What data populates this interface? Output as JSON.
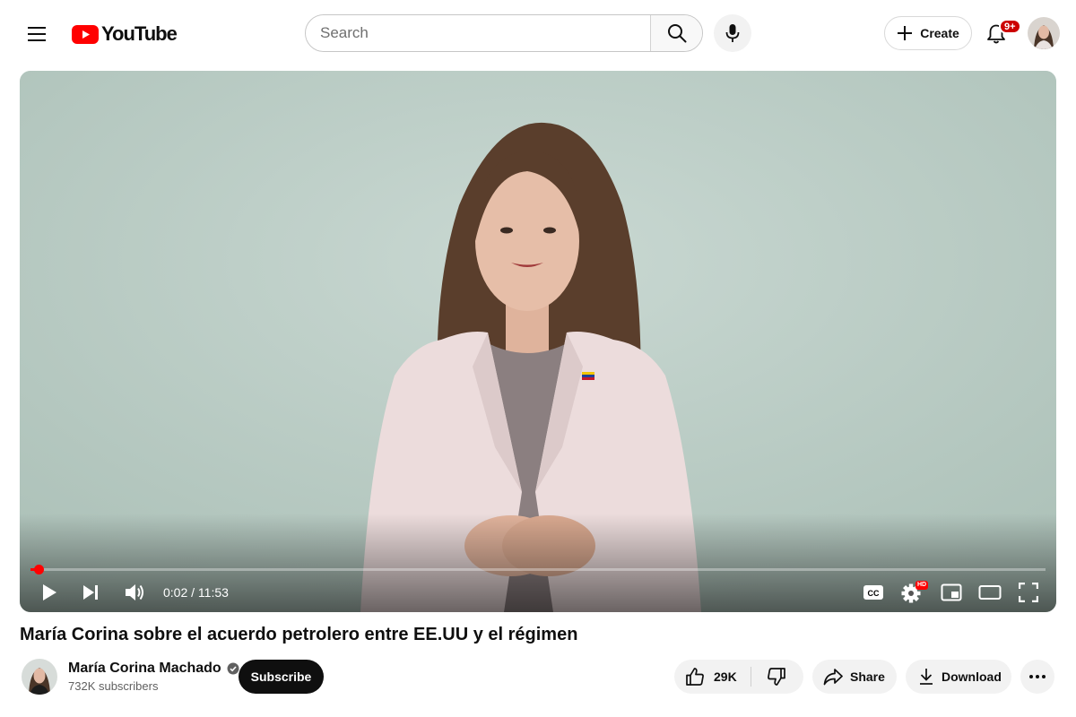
{
  "masthead": {
    "logo_text": "YouTube",
    "search_placeholder": "Search",
    "create_label": "Create",
    "notifications_badge": "9+"
  },
  "player": {
    "current_time": "0:02",
    "separator": " / ",
    "duration": "11:53",
    "progress_fraction": 0.003,
    "quality_badge": "HD"
  },
  "video": {
    "title": "María Corina sobre el acuerdo petrolero entre EE.UU y el régimen"
  },
  "channel": {
    "name": "María Corina Machado",
    "verified": true,
    "subscribers": "732K subscribers",
    "subscribe_label": "Subscribe"
  },
  "actions": {
    "like_count": "29K",
    "share_label": "Share",
    "download_label": "Download"
  },
  "colors": {
    "brand_red": "#ff0000",
    "badge_red": "#cc0000",
    "text_primary": "#0f0f0f",
    "text_secondary": "#606060"
  }
}
